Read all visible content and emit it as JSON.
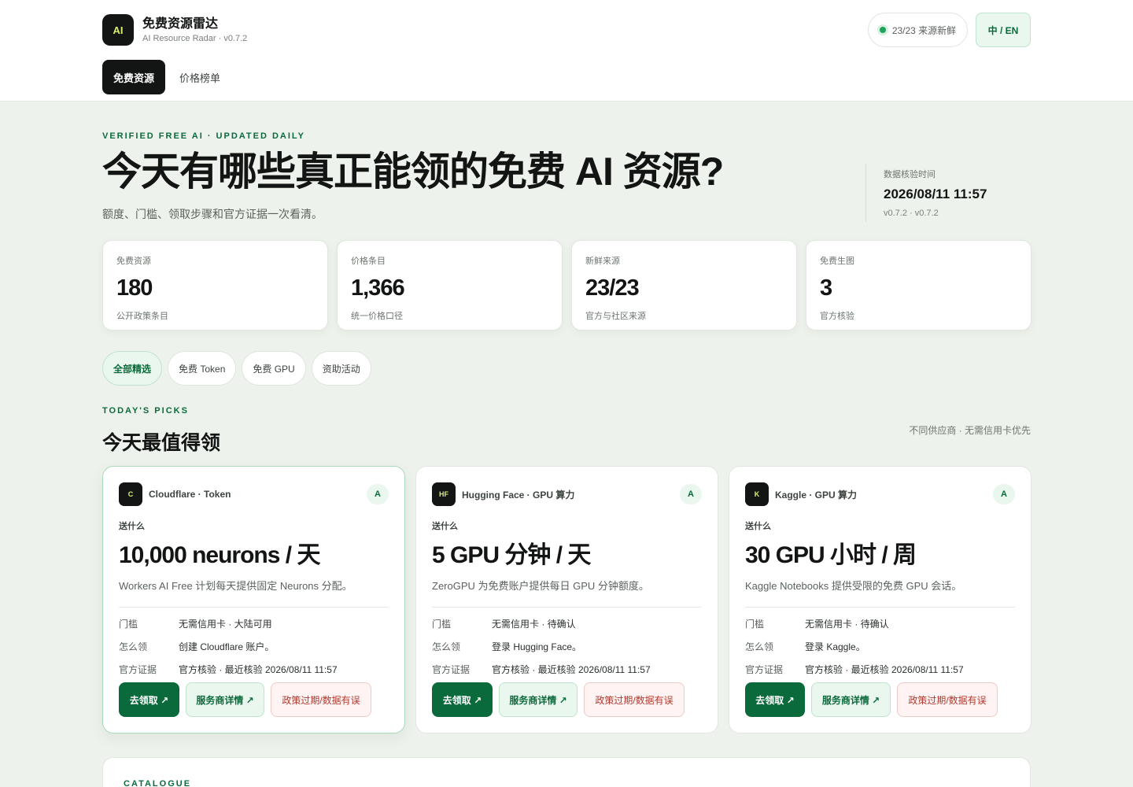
{
  "header": {
    "logo_text": "AI",
    "app_name": "免费资源雷达",
    "app_sub": "AI Resource Radar · v0.7.2",
    "status": "23/23 来源新鲜",
    "lang_toggle": "中 / EN",
    "tabs": [
      {
        "label": "免费资源"
      },
      {
        "label": "价格榜单"
      }
    ]
  },
  "hero": {
    "eyebrow": "VERIFIED FREE AI · UPDATED DAILY",
    "title": "今天有哪些真正能领的免费 AI 资源?",
    "subtitle": "额度、门槛、领取步骤和官方证据一次看清。",
    "verify_label": "数据核验时间",
    "verify_time": "2026/08/11 11:57",
    "verify_version": "v0.7.2 · v0.7.2"
  },
  "stats": [
    {
      "label": "免费资源",
      "value": "180",
      "note": "公开政策条目"
    },
    {
      "label": "价格条目",
      "value": "1,366",
      "note": "统一价格口径"
    },
    {
      "label": "新鲜来源",
      "value": "23/23",
      "note": "官方与社区来源"
    },
    {
      "label": "免费生图",
      "value": "3",
      "note": "官方核验"
    }
  ],
  "filters": [
    {
      "label": "全部精选"
    },
    {
      "label": "免费 Token"
    },
    {
      "label": "免费 GPU"
    },
    {
      "label": "资助活动"
    }
  ],
  "picks": {
    "eyebrow": "TODAY'S PICKS",
    "title": "今天最值得领",
    "note": "不同供应商 · 无需信用卡优先"
  },
  "card_labels": {
    "what": "送什么",
    "threshold": "门槛",
    "how": "怎么领",
    "evidence": "官方证据",
    "claim_button": "去领取 ↗",
    "details_button": "服务商详情 ↗",
    "report_button": "政策过期/数据有误"
  },
  "cards": [
    {
      "logo": "C",
      "provider": "Cloudflare · Token",
      "grade": "A",
      "amount": "10,000 neurons / 天",
      "description": "Workers AI Free 计划每天提供固定 Neurons 分配。",
      "threshold": "无需信用卡 · 大陆可用",
      "how": "创建 Cloudflare 账户。",
      "evidence": "官方核验 · 最近核验 2026/08/11 11:57"
    },
    {
      "logo": "HF",
      "provider": "Hugging Face · GPU 算力",
      "grade": "A",
      "amount": "5 GPU 分钟 / 天",
      "description": "ZeroGPU 为免费账户提供每日 GPU 分钟额度。",
      "threshold": "无需信用卡 · 待确认",
      "how": "登录 Hugging Face。",
      "evidence": "官方核验 · 最近核验 2026/08/11 11:57"
    },
    {
      "logo": "K",
      "provider": "Kaggle · GPU 算力",
      "grade": "A",
      "amount": "30 GPU 小时 / 周",
      "description": "Kaggle Notebooks 提供受限的免费 GPU 会话。",
      "threshold": "无需信用卡 · 待确认",
      "how": "登录 Kaggle。",
      "evidence": "官方核验 · 最近核验 2026/08/11 11:57"
    }
  ],
  "catalogue": {
    "eyebrow": "CATALOGUE"
  },
  "colors": {
    "brand_green": "#0b6a3b",
    "accent_lime": "#d8f06a",
    "report_red": "#b3382c"
  }
}
